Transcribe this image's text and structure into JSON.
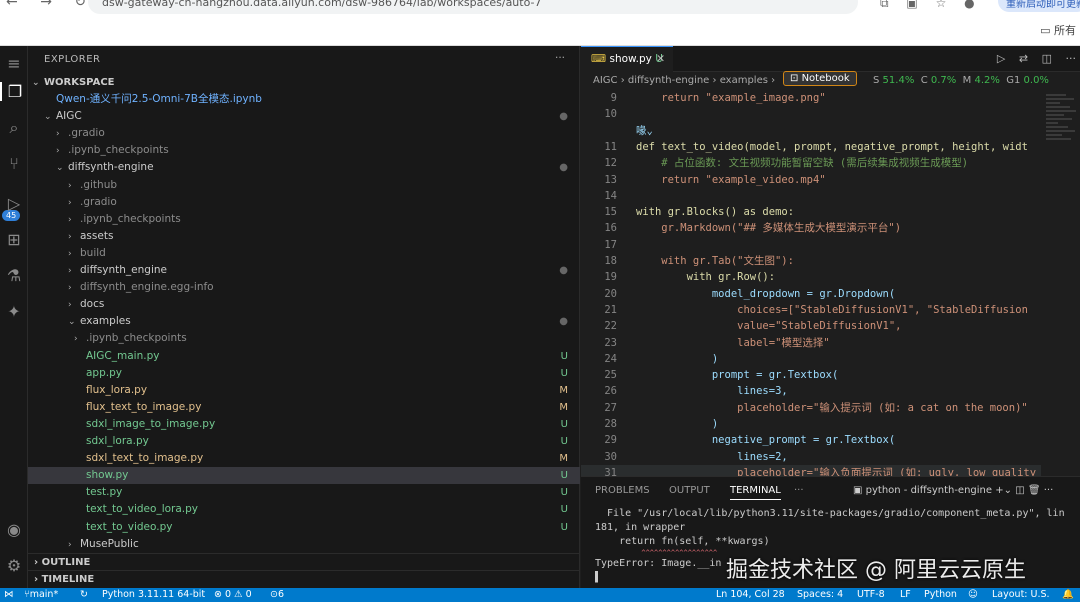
{
  "browser": {
    "url": "dsw-gateway-cn-hangzhou.data.aliyun.com/dsw-986764/lab/workspaces/auto-7",
    "update_button": "重新启动即可更新",
    "bookmarks": "所有"
  },
  "activity": {
    "badge": "45",
    "account_badge": "1"
  },
  "explorer": {
    "title": "EXPLORER",
    "more": "···",
    "workspace": "WORKSPACE",
    "items": [
      {
        "label": "Qwen-通义千问2.5-Omni-7B全模态.ipynb",
        "chev": "",
        "status": ""
      },
      {
        "label": "AIGC",
        "chev": "⌄",
        "status": "●"
      },
      {
        "label": ".gradio",
        "chev": "›",
        "status": ""
      },
      {
        "label": ".ipynb_checkpoints",
        "chev": "›",
        "status": ""
      },
      {
        "label": "diffsynth-engine",
        "chev": "⌄",
        "status": "●"
      },
      {
        "label": ".github",
        "chev": "›",
        "status": ""
      },
      {
        "label": ".gradio",
        "chev": "›",
        "status": ""
      },
      {
        "label": ".ipynb_checkpoints",
        "chev": "›",
        "status": ""
      },
      {
        "label": "assets",
        "chev": "›",
        "status": ""
      },
      {
        "label": "build",
        "chev": "›",
        "status": ""
      },
      {
        "label": "diffsynth_engine",
        "chev": "›",
        "status": "●"
      },
      {
        "label": "diffsynth_engine.egg-info",
        "chev": "›",
        "status": ""
      },
      {
        "label": "docs",
        "chev": "›",
        "status": ""
      },
      {
        "label": "examples",
        "chev": "⌄",
        "status": "●"
      },
      {
        "label": ".ipynb_checkpoints",
        "chev": "›",
        "status": ""
      },
      {
        "label": "AIGC_main.py",
        "chev": "",
        "status": "U"
      },
      {
        "label": "app.py",
        "chev": "",
        "status": "U"
      },
      {
        "label": "flux_lora.py",
        "chev": "",
        "status": "M"
      },
      {
        "label": "flux_text_to_image.py",
        "chev": "",
        "status": "M"
      },
      {
        "label": "sdxl_image_to_image.py",
        "chev": "",
        "status": "U"
      },
      {
        "label": "sdxl_lora.py",
        "chev": "",
        "status": "U"
      },
      {
        "label": "sdxl_text_to_image.py",
        "chev": "",
        "status": "M"
      },
      {
        "label": "show.py",
        "chev": "",
        "status": "U"
      },
      {
        "label": "test.py",
        "chev": "",
        "status": "U"
      },
      {
        "label": "text_to_video_lora.py",
        "chev": "",
        "status": "U"
      },
      {
        "label": "text_to_video.py",
        "chev": "",
        "status": "U"
      },
      {
        "label": "MusePublic",
        "chev": "›",
        "status": ""
      }
    ],
    "outline": "OUTLINE",
    "timeline": "TIMELINE"
  },
  "editor": {
    "tab_name": "show.py",
    "tab_status": "U",
    "breadcrumb": "AIGC › diffsynth-engine › examples ›",
    "notebook_badge": "Notebook",
    "metrics": {
      "s_label": "S",
      "s_val": "51.4%",
      "c_label": "C",
      "c_val": "0.7%",
      "m_label": "M",
      "m_val": "4.2%",
      "g_label": "G1",
      "g_val": "0.0%"
    },
    "lines": [
      {
        "n": "9",
        "code": "    return \"example_image.png\""
      },
      {
        "n": "10",
        "code": ""
      },
      {
        "n": "",
        "code": "喙⌄"
      },
      {
        "n": "11",
        "code": "def text_to_video(model, prompt, negative_prompt, height, widt"
      },
      {
        "n": "12",
        "code": "    # 占位函数: 文生视频功能暂留空缺 (需后续集成视频生成模型)"
      },
      {
        "n": "13",
        "code": "    return \"example_video.mp4\""
      },
      {
        "n": "14",
        "code": ""
      },
      {
        "n": "15",
        "code": "with gr.Blocks() as demo:"
      },
      {
        "n": "16",
        "code": "    gr.Markdown(\"## 多媒体生成大模型演示平台\")"
      },
      {
        "n": "17",
        "code": ""
      },
      {
        "n": "18",
        "code": "    with gr.Tab(\"文生图\"):"
      },
      {
        "n": "19",
        "code": "        with gr.Row():"
      },
      {
        "n": "20",
        "code": "            model_dropdown = gr.Dropdown("
      },
      {
        "n": "21",
        "code": "                choices=[\"StableDiffusionV1\", \"StableDiffusion"
      },
      {
        "n": "22",
        "code": "                value=\"StableDiffusionV1\","
      },
      {
        "n": "23",
        "code": "                label=\"模型选择\""
      },
      {
        "n": "24",
        "code": "            )"
      },
      {
        "n": "25",
        "code": "            prompt = gr.Textbox("
      },
      {
        "n": "26",
        "code": "                lines=3,"
      },
      {
        "n": "27",
        "code": "                placeholder=\"输入提示词 (如: a cat on the moon)\""
      },
      {
        "n": "28",
        "code": "            )"
      },
      {
        "n": "29",
        "code": "            negative_prompt = gr.Textbox("
      },
      {
        "n": "30",
        "code": "                lines=2,"
      },
      {
        "n": "31",
        "code": "                placeholder=\"输入负面提示词 (如: ugly, low quality"
      }
    ]
  },
  "panel": {
    "tabs": [
      "PROBLEMS",
      "OUTPUT",
      "TERMINAL",
      "···"
    ],
    "terminal_selector": "python - diffsynth-engine",
    "terminal_lines": [
      "  File \"/usr/local/lib/python3.11/site-packages/gradio/component_meta.py\", lin",
      "181, in wrapper",
      "    return fn(self, **kwargs)",
      "           ^^^^^^^^^^^^^^^^^^",
      "TypeError: Image.__in"
    ],
    "watermark": "掘金技术社区 @ 阿里云云原生"
  },
  "statusbar": {
    "branch": "main*",
    "python": "Python 3.11.11 64-bit",
    "errors": "⊗ 0 ⚠ 0",
    "ports": "6",
    "position": "Ln 104, Col 28",
    "spaces": "Spaces: 4",
    "encoding": "UTF-8",
    "eol": "LF",
    "language": "Python",
    "layout": "Layout: U.S."
  },
  "colors": {
    "accent": "#007acc",
    "untracked": "#73c991",
    "modified": "#e2c08d"
  }
}
